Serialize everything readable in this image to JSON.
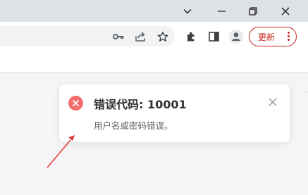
{
  "window": {
    "buttons": [
      "chevron-down-icon",
      "minimize-icon",
      "restore-icon",
      "close-icon"
    ]
  },
  "toolbar": {
    "icons": [
      "key-icon",
      "share-icon",
      "star-icon",
      "extensions-icon",
      "side-panel-icon",
      "profile-avatar-icon"
    ],
    "update_label": "更新",
    "accent": "#c5221f"
  },
  "toast": {
    "title": "错误代码: 10001",
    "message": "用户名或密码错误。",
    "type": "error",
    "icon_color": "#f56c6c"
  },
  "annotation": {
    "arrow_color": "#e03a3a"
  }
}
